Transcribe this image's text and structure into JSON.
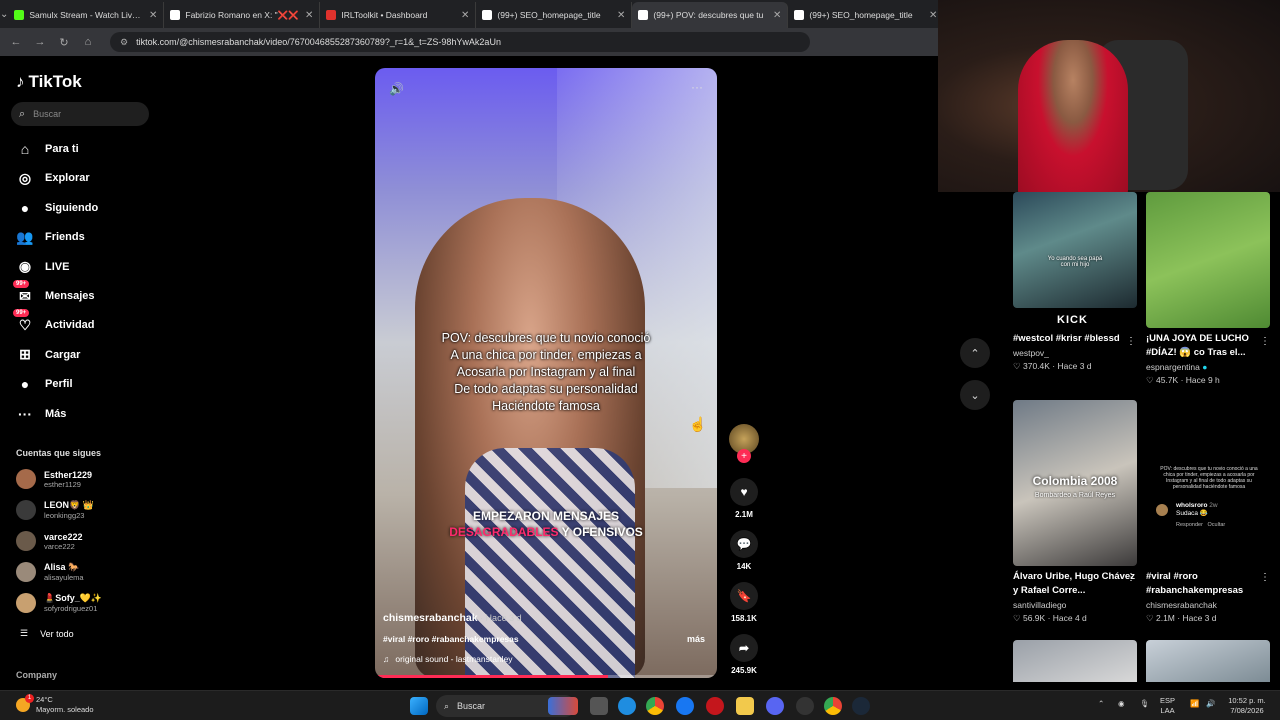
{
  "browser": {
    "tabs": [
      {
        "title": "Samulx Stream - Watch Live on",
        "color": "#53fc18"
      },
      {
        "title": "Fabrizio Romano en X: \"❌❌",
        "color": "#ffffff"
      },
      {
        "title": "IRLToolkit • Dashboard",
        "color": "#e0322d"
      },
      {
        "title": "(99+) SEO_homepage_title",
        "color": "#ffffff"
      },
      {
        "title": "(99+) POV: descubres que tu",
        "color": "#ffffff"
      },
      {
        "title": "(99+) SEO_homepage_title",
        "color": "#ffffff"
      }
    ],
    "url": "tiktok.com/@chismesrabanchak/video/7670046855287360789?_r=1&_t=ZS-98hYwAk2aUn"
  },
  "sidebar": {
    "logo": "TikTok",
    "search_placeholder": "Buscar",
    "nav": [
      {
        "label": "Para ti",
        "icon": "home-icon"
      },
      {
        "label": "Explorar",
        "icon": "compass-icon"
      },
      {
        "label": "Siguiendo",
        "icon": "following-icon"
      },
      {
        "label": "Friends",
        "icon": "friends-icon"
      },
      {
        "label": "LIVE",
        "icon": "live-icon"
      },
      {
        "label": "Mensajes",
        "icon": "messages-icon",
        "badge": "99+"
      },
      {
        "label": "Actividad",
        "icon": "activity-icon",
        "badge": "99+"
      },
      {
        "label": "Cargar",
        "icon": "upload-icon"
      },
      {
        "label": "Perfil",
        "icon": "profile-icon"
      },
      {
        "label": "Más",
        "icon": "more-icon"
      }
    ],
    "following_title": "Cuentas que sigues",
    "following": [
      {
        "name": "Esther1229",
        "handle": "esther1129"
      },
      {
        "name": "LEON🦁 👑",
        "handle": "leonkingg23"
      },
      {
        "name": "varce222",
        "handle": "varce222"
      },
      {
        "name": "Alisa 🐎",
        "handle": "alisayulema"
      },
      {
        "name": "💄Sofy_💛✨",
        "handle": "sofyrodriguez01"
      }
    ],
    "see_all": "Ver todo",
    "company": "Company"
  },
  "video": {
    "caption_lines": [
      "POV: descubres que tu novio conoció",
      "A una chica por tinder, empiezas a",
      "Acosarla por Instagram y al final",
      "De todo adaptas su personalidad",
      "Haciéndote famosa"
    ],
    "subtitle_line1": "EMPEZARON MENSAJES",
    "subtitle_pink": "DESAGRADABLES",
    "subtitle_rest": " Y OFENSIVOS",
    "author": "chismesrabanchak",
    "age": " · Hace 3 d",
    "tags": "#viral #roro #rabanchakempresas",
    "more": "más",
    "sound": "original sound - lastmanstanley",
    "progress": 0.68,
    "likes": "2.1M",
    "comments": "14K",
    "saves": "158.1K",
    "shares": "245.9K"
  },
  "grid": [
    {
      "title": "#westcol #krisr #blessd",
      "author": "westpov_",
      "views": "370.4K",
      "age": "Hace 3 d",
      "thumb_text": "Yo cuando sea papá con mi hijo",
      "brand": "KICK"
    },
    {
      "title": "¡UNA JOYA DE LUCHO #DÍAZ! 😱 co Tras el...",
      "author": "espnargentina",
      "views": "45.7K",
      "age": "Hace 9 h"
    },
    {
      "title": "Álvaro Uribe, Hugo Chávez y Rafael Corre...",
      "author": "santivilladiego",
      "views": "56.9K",
      "age": "Hace 4 d",
      "thumb_text": "Colombia 2008",
      "thumb_sub": "Bombardeo a Raúl Reyes"
    },
    {
      "title": "#viral #roro #rabanchakempresas",
      "author": "chismesrabanchak",
      "views": "2.1M",
      "age": "Hace 3 d",
      "thumb_text": "POV: descubres que tu novio conoció a una chica por tinder, empiezas a acosarla por Instagram y al final de todo adaptas su personalidad haciéndote famosa",
      "comment_user": "wholsroro",
      "comment_age": "2w",
      "comment_text": "Sudaca 😂",
      "reply": "Responder",
      "hide": "Ocultar"
    }
  ],
  "taskbar": {
    "temp": "24°C",
    "weather": "Mayorm. soleado",
    "search": "Buscar",
    "lang1": "ESP",
    "lang2": "LAA",
    "time": "10:52 p. m.",
    "date": "7/08/2026"
  }
}
